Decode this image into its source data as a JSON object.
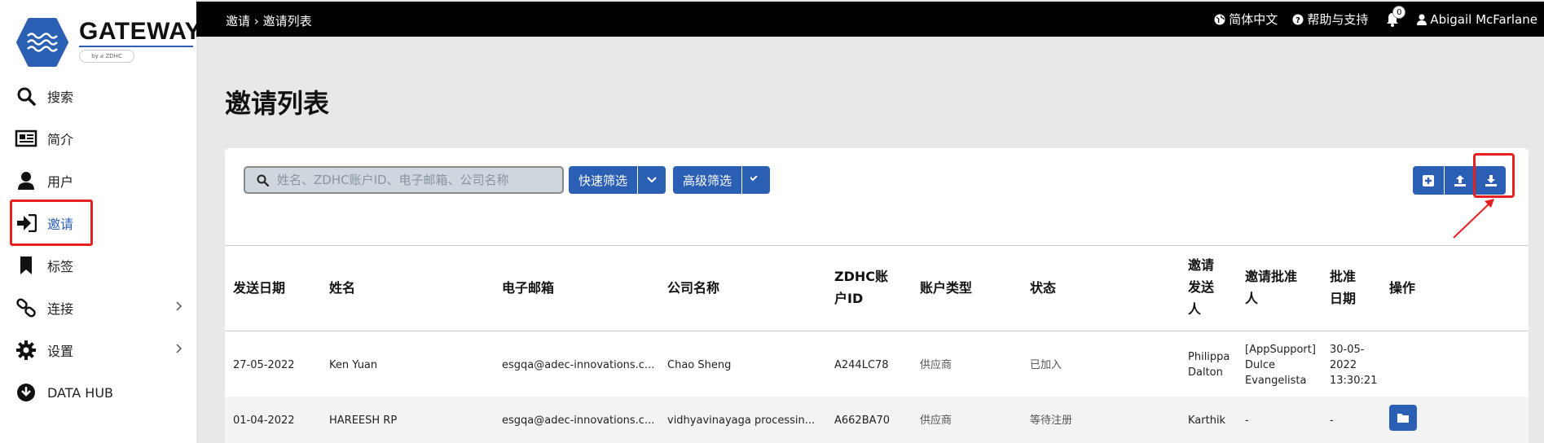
{
  "app": {
    "logo_text": "GATEWAY",
    "logo_sub": "by ⌀ ZDHC"
  },
  "sidebar": {
    "items": [
      {
        "label": "搜索",
        "icon": "search-icon"
      },
      {
        "label": "简介",
        "icon": "newspaper-icon"
      },
      {
        "label": "用户",
        "icon": "user-icon"
      },
      {
        "label": "邀请",
        "icon": "sign-in-icon",
        "active": true
      },
      {
        "label": "标签",
        "icon": "bookmark-icon"
      },
      {
        "label": "连接",
        "icon": "link-icon",
        "has_children": true
      },
      {
        "label": "设置",
        "icon": "gear-icon",
        "has_children": true
      },
      {
        "label": "DATA HUB",
        "icon": "download-circle-icon"
      }
    ]
  },
  "topbar": {
    "breadcrumb": [
      "邀请",
      "邀请列表"
    ],
    "language": "简体中文",
    "help": "帮助与支持",
    "notifications": "0",
    "user": "Abigail McFarlane"
  },
  "page": {
    "title": "邀请列表"
  },
  "toolbar": {
    "search_placeholder": "姓名、ZDHC账户ID、电子邮箱、公司名称",
    "quick_filter": "快速筛选",
    "advanced_filter": "高级筛选"
  },
  "table": {
    "headers": [
      "发送日期",
      "姓名",
      "电子邮箱",
      "公司名称",
      "ZDHC账户ID",
      "账户类型",
      "状态",
      "邀请发送人",
      "邀请批准人",
      "批准日期",
      "操作"
    ],
    "rows": [
      {
        "date": "27-05-2022",
        "name": "Ken Yuan",
        "email": "esgqa@adec-innovations.c...",
        "company": "Chao Sheng",
        "account_id": "A244LC78",
        "type": "供应商",
        "status": "已加入",
        "sender": "Philippa Dalton",
        "approver": "[AppSupport] Dulce Evangelista",
        "approved_date": "30-05-2022 13:30:21"
      },
      {
        "date": "01-04-2022",
        "name": "HAREESH RP",
        "email": "esgqa@adec-innovations.c...",
        "company": "vidhyavinayaga processin...",
        "account_id": "A662BA70",
        "type": "供应商",
        "status": "等待注册",
        "sender": "Karthik",
        "approver": "-",
        "approved_date": "-"
      }
    ]
  },
  "colors": {
    "primary": "#2b5fb4",
    "highlight": "#e62020",
    "topbar": "#000000"
  }
}
